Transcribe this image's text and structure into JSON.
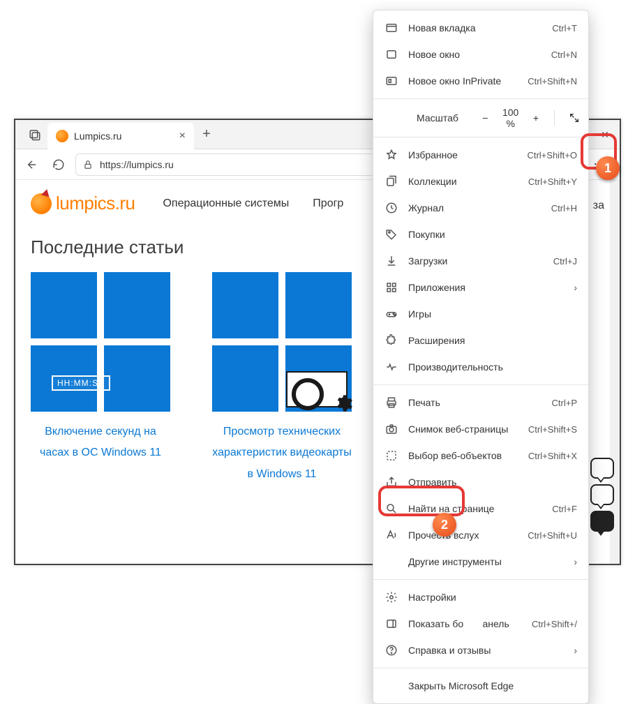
{
  "tab": {
    "title": "Lumpics.ru"
  },
  "url": "https://lumpics.ru",
  "logo_text": "lumpics.ru",
  "nav": {
    "os": "Операционные системы",
    "prog_prefix": "Прогр",
    "za_suffix": "за"
  },
  "section": "Последние статьи",
  "cards": [
    {
      "badge": "HH:MM:SS",
      "title": "Включение секунд на часах в ОС Windows 11"
    },
    {
      "title": "Просмотр технических характеристик видеокарты в Windows 11"
    }
  ],
  "zoom": {
    "label": "Масштаб",
    "value": "100 %"
  },
  "menu": {
    "new_tab": {
      "label": "Новая вкладка",
      "shortcut": "Ctrl+T"
    },
    "new_window": {
      "label": "Новое окно",
      "shortcut": "Ctrl+N"
    },
    "inprivate": {
      "label": "Новое окно InPrivate",
      "shortcut": "Ctrl+Shift+N"
    },
    "favorites": {
      "label": "Избранное",
      "shortcut": "Ctrl+Shift+O"
    },
    "collections": {
      "label": "Коллекции",
      "shortcut": "Ctrl+Shift+Y"
    },
    "history": {
      "label": "Журнал",
      "shortcut": "Ctrl+H"
    },
    "shopping": {
      "label": "Покупки",
      "shortcut": ""
    },
    "downloads": {
      "label": "Загрузки",
      "shortcut": "Ctrl+J"
    },
    "apps": {
      "label": "Приложения",
      "shortcut": "",
      "sub": true
    },
    "games": {
      "label": "Игры",
      "shortcut": ""
    },
    "extensions": {
      "label": "Расширения",
      "shortcut": ""
    },
    "performance": {
      "label": "Производительность",
      "shortcut": ""
    },
    "print": {
      "label": "Печать",
      "shortcut": "Ctrl+P"
    },
    "capture": {
      "label": "Снимок веб-страницы",
      "shortcut": "Ctrl+Shift+S"
    },
    "webselect": {
      "label": "Выбор веб-объектов",
      "shortcut": "Ctrl+Shift+X"
    },
    "share": {
      "label": "Отправить",
      "shortcut": ""
    },
    "find": {
      "label": "Найти на странице",
      "shortcut": "Ctrl+F"
    },
    "readaloud": {
      "label": "Прочесть вслух",
      "shortcut": "Ctrl+Shift+U"
    },
    "moretools": {
      "label": "Другие инструменты",
      "shortcut": "",
      "sub": true
    },
    "settings": {
      "label": "Настройки",
      "shortcut": ""
    },
    "sidebar": {
      "label_a": "Показать бо",
      "label_b": "анель",
      "shortcut": "Ctrl+Shift+/"
    },
    "help": {
      "label": "Справка и отзывы",
      "shortcut": "",
      "sub": true
    },
    "close": {
      "label": "Закрыть Microsoft Edge"
    }
  },
  "badges": {
    "one": "1",
    "two": "2"
  }
}
